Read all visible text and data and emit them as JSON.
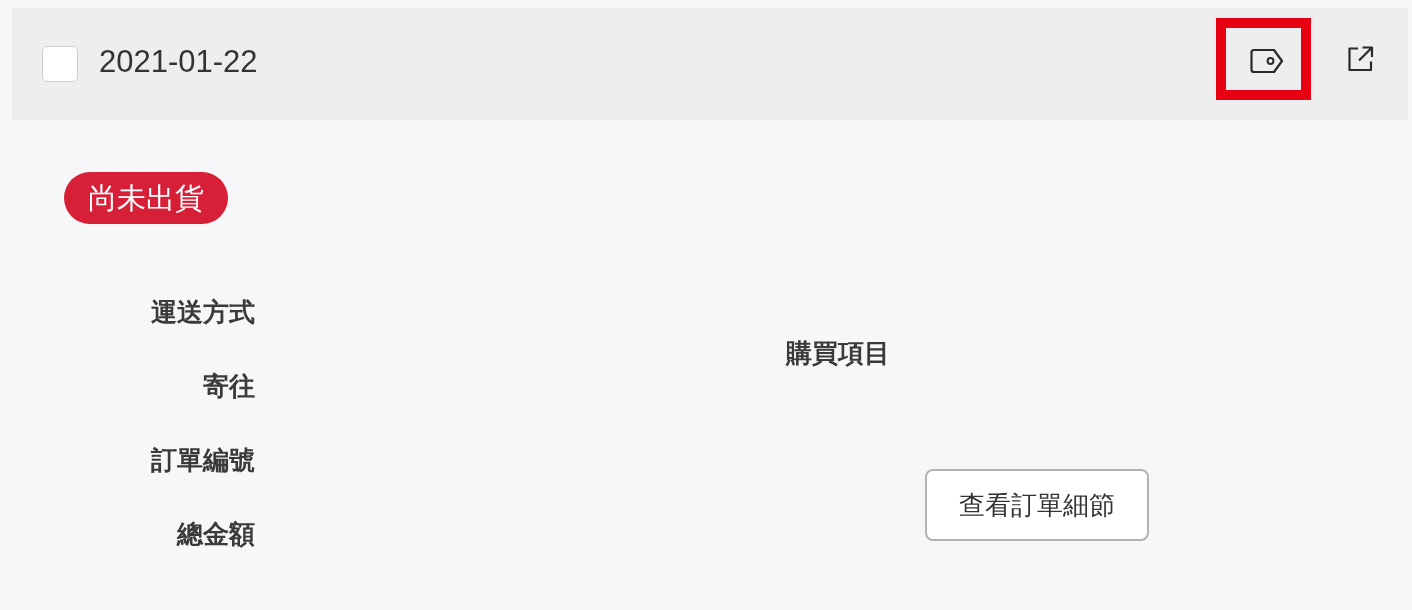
{
  "header": {
    "checkbox": {
      "checked": false
    },
    "date": "2021-01-22",
    "actions": [
      {
        "kind": "tag",
        "highlighted": true
      },
      {
        "kind": "external-link",
        "highlighted": false
      }
    ]
  },
  "status": {
    "label": "尚未出貨"
  },
  "fields": [
    {
      "label": "運送方式"
    },
    {
      "label": "寄往"
    },
    {
      "label": "訂單編號"
    },
    {
      "label": "總金額"
    }
  ],
  "purchase_items": {
    "heading": "購買項目"
  },
  "details_button": {
    "label": "查看訂單細節"
  }
}
